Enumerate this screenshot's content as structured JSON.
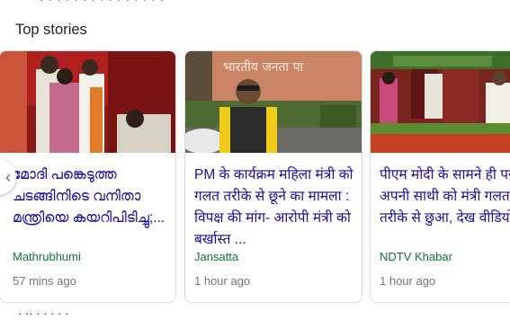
{
  "section": {
    "title": "Top stories"
  },
  "stories": [
    {
      "headline": "മോദി പങ്കെടുത്ത ചടങ്ങിനിടെ വനിതാ മന്ത്രിയെ കയറിപിടിച്ചു;...",
      "source": "Mathrubhumi",
      "time": "57 mins ago"
    },
    {
      "headline": "PM के कार्यक्रम महिला मंत्री को गलत तरीके से छूने का मामला : विपक्ष की मांग- आरोपी मंत्री को बर्खास्त ...",
      "source": "Jansatta",
      "time": "1 hour ago",
      "image_sign_text": "भारतीय जनता पा"
    },
    {
      "headline": "पीएम मोदी के सामने ही पर अपनी साथी को मंत्री गलत तरीके से छुआ, देख वीडियो",
      "source": "NDTV Khabar",
      "time": "1 hour ago"
    }
  ],
  "colors": {
    "link": "#1a0dab",
    "source": "#137333",
    "meta": "#70757a"
  },
  "icons": {
    "carousel_prev": "chevron-left-icon"
  }
}
